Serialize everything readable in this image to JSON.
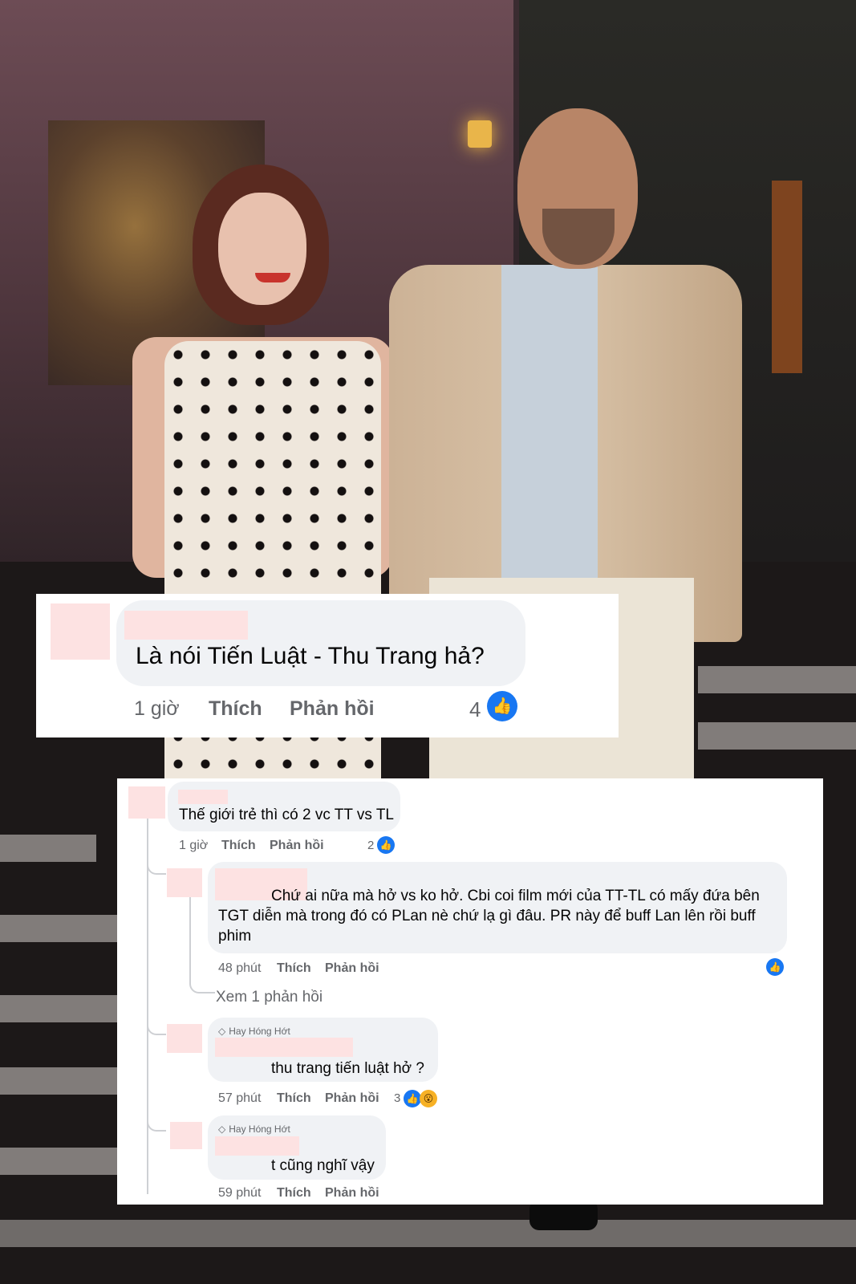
{
  "top_comment": {
    "text": "Là nói Tiến Luật - Thu Trang hả?",
    "time": "1 giờ",
    "like_label": "Thích",
    "reply_label": "Phản hồi",
    "reaction_count": "4"
  },
  "thread": {
    "main": {
      "text": "Thế giới trẻ thì có 2 vc TT vs TL",
      "time": "1 giờ",
      "like_label": "Thích",
      "reply_label": "Phản hồi",
      "reaction_count": "2"
    },
    "replies": [
      {
        "lines": [
          "Chứ ai nữa mà hở vs ko hở. Cbi coi film mới của TT-TL có mấy đứa bên",
          "TGT diễn mà trong đó có PLan nè chứ lạ gì đâu. PR này để buff Lan lên rồi buff",
          "phim"
        ],
        "time": "48 phút",
        "like_label": "Thích",
        "reply_label": "Phản hồi"
      },
      {
        "badge": "Hay Hóng Hớt",
        "text": "thu trang tiến luật hở ?",
        "time": "57 phút",
        "like_label": "Thích",
        "reply_label": "Phản hồi",
        "reaction_count": "3"
      },
      {
        "badge": "Hay Hóng Hớt",
        "text": "t cũng nghĩ vậy",
        "time": "59 phút",
        "like_label": "Thích",
        "reply_label": "Phản hồi"
      }
    ],
    "view_more": "Xem 1 phản hồi"
  },
  "icons": {
    "like": "like-icon",
    "wow": "wow-icon",
    "badge": "gem-icon"
  },
  "colors": {
    "like_blue": "#1877f2",
    "bubble_gray": "#f0f2f5",
    "meta_gray": "#65676b",
    "redaction_pink": "#fde2e2"
  }
}
